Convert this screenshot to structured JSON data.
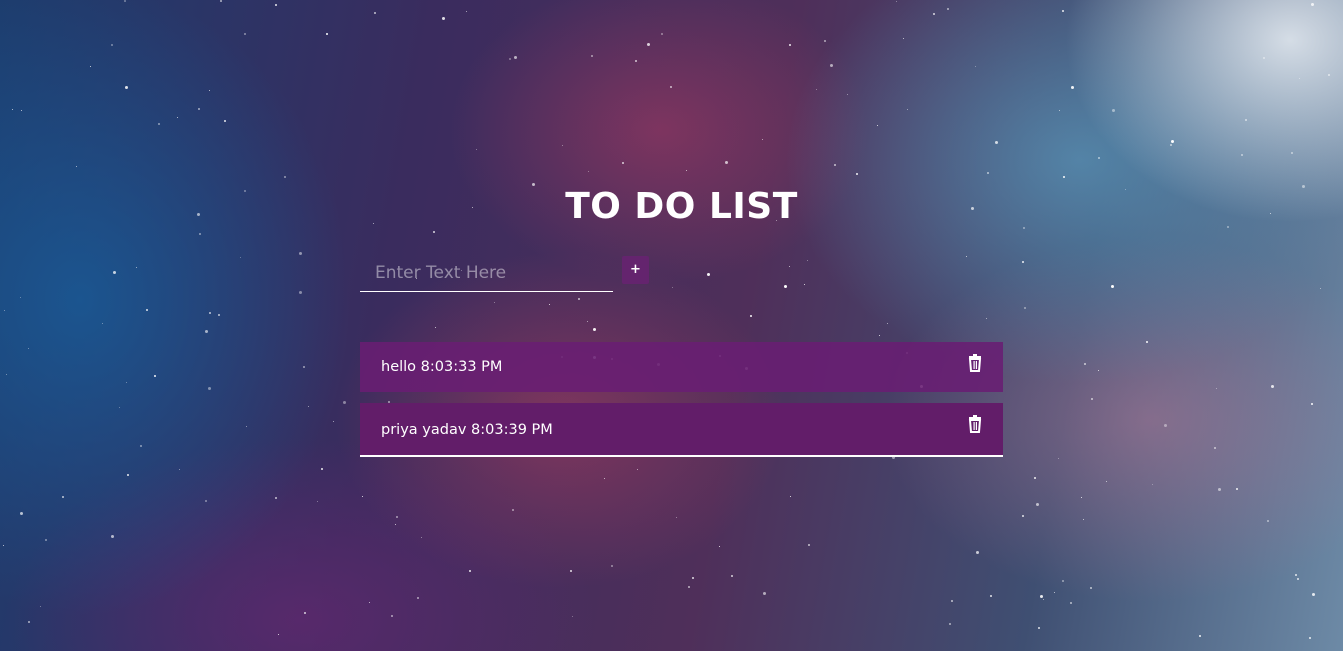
{
  "app": {
    "title": "TO DO LIST"
  },
  "input": {
    "placeholder": "Enter Text Here",
    "value": ""
  },
  "add_button": {
    "label": "+"
  },
  "items": [
    {
      "text": "hello 8:03:33 PM"
    },
    {
      "text": "priya yadav 8:03:39 PM"
    }
  ],
  "colors": {
    "item_background": "#691e73",
    "button_background": "#64246e",
    "text": "#ffffff"
  },
  "icons": {
    "delete": "trash-icon"
  }
}
